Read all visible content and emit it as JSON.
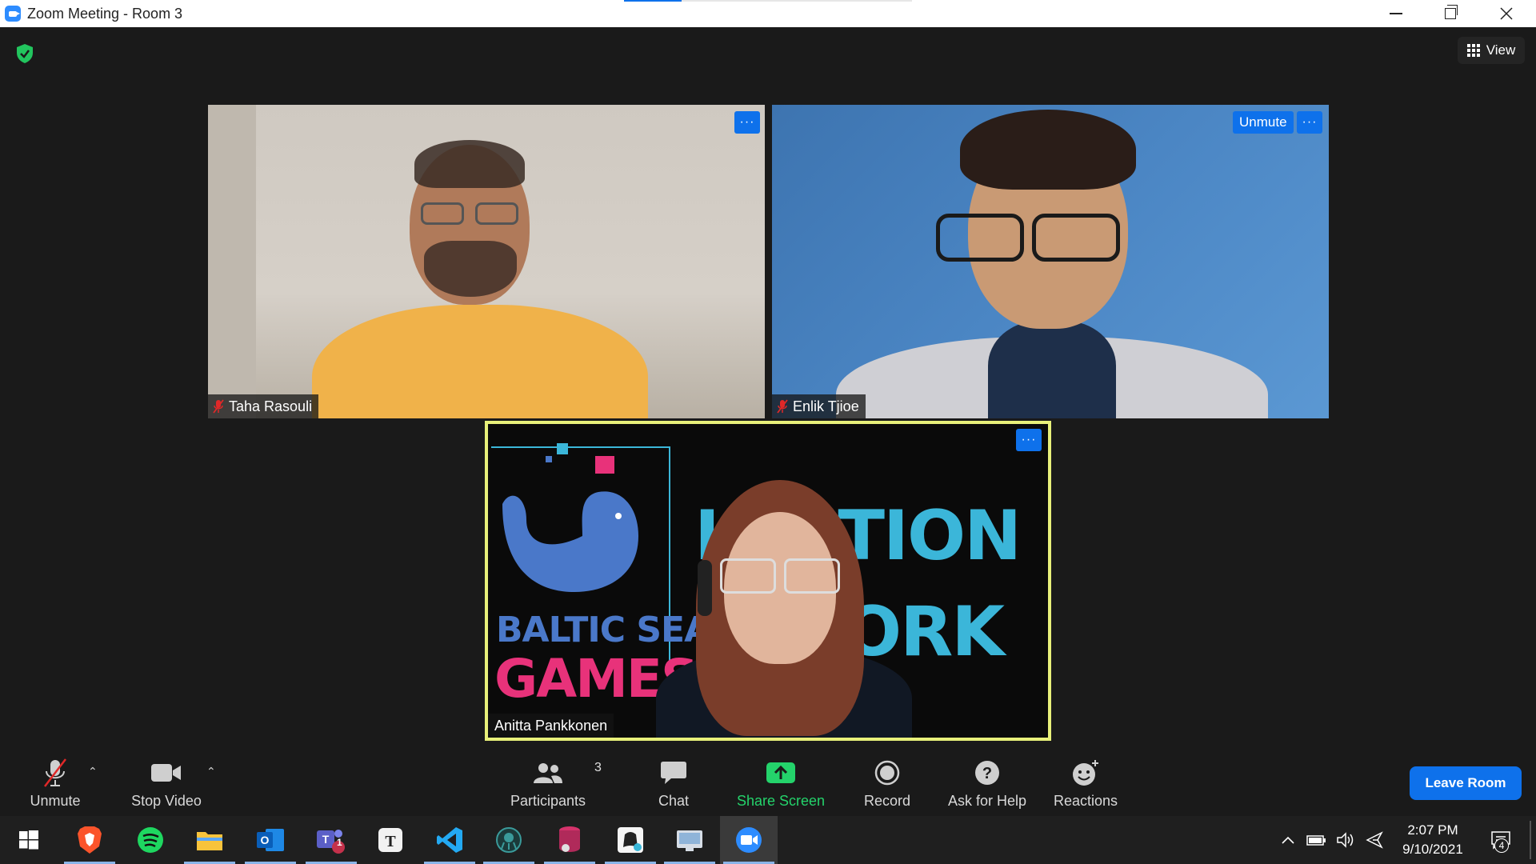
{
  "window": {
    "title": "Zoom Meeting - Room 3"
  },
  "meeting": {
    "view_label": "View",
    "participants": [
      {
        "name": "Taha Rasouli",
        "muted": true
      },
      {
        "name": "Enlik Tjioe",
        "muted": true,
        "unmute_label": "Unmute"
      },
      {
        "name": "Anitta Pankkonen",
        "muted": false,
        "active_speaker": true
      }
    ],
    "more_label": "···",
    "background": {
      "baltic": "BALTIC SEA",
      "games": "GAMES",
      "incubation": "I   BATION",
      "network": "ORK"
    }
  },
  "toolbar": {
    "unmute": "Unmute",
    "stop_video": "Stop Video",
    "participants": "Participants",
    "participants_count": "3",
    "chat": "Chat",
    "share_screen": "Share Screen",
    "record": "Record",
    "ask_for_help": "Ask for Help",
    "reactions": "Reactions",
    "leave_room": "Leave Room"
  },
  "taskbar": {
    "apps": [
      "windows-start",
      "brave",
      "spotify",
      "file-explorer",
      "outlook",
      "teams",
      "typora",
      "vscode",
      "gitkraken",
      "database-tool",
      "inkscape",
      "remote-desktop",
      "zoom"
    ],
    "teams_badge": "1",
    "time": "2:07 PM",
    "date": "9/10/2021",
    "notification_count": "4"
  },
  "colors": {
    "accent": "#0e71eb",
    "share_green": "#24d36b",
    "active_speaker_border": "#e8f07a",
    "mute_red": "#e02828"
  }
}
